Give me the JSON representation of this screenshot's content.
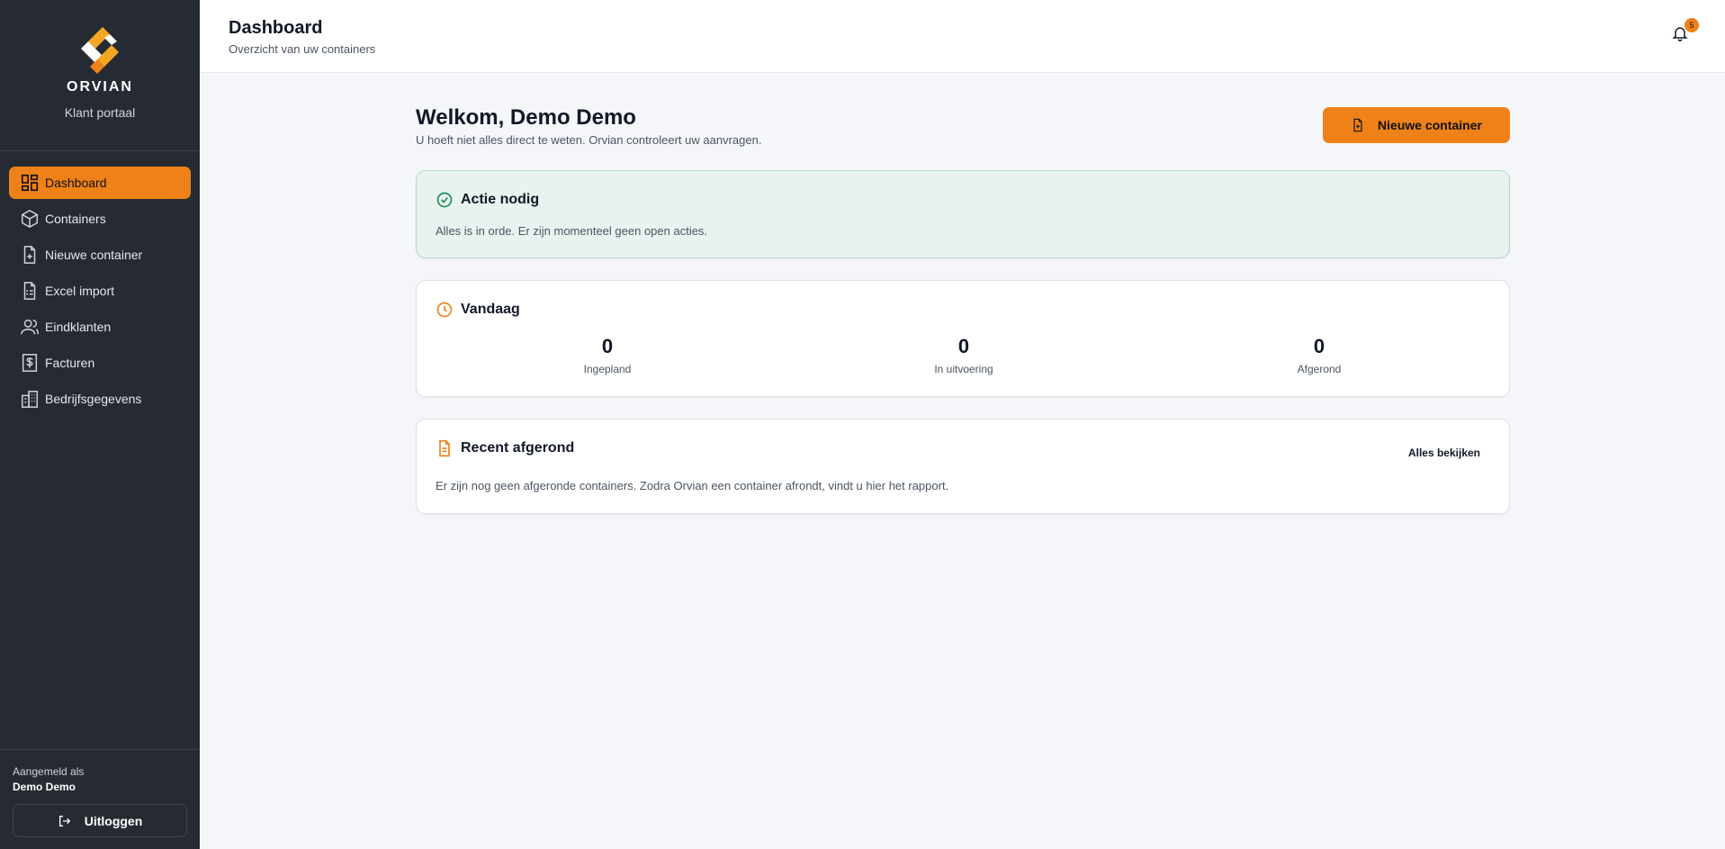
{
  "brand": {
    "name": "ORVIAN",
    "subtitle": "Klant portaal"
  },
  "sidebar": {
    "items": [
      {
        "label": "Dashboard",
        "icon": "dashboard-icon",
        "active": true
      },
      {
        "label": "Containers",
        "icon": "box-icon"
      },
      {
        "label": "Nieuwe container",
        "icon": "file-plus-icon"
      },
      {
        "label": "Excel import",
        "icon": "spreadsheet-icon"
      },
      {
        "label": "Eindklanten",
        "icon": "users-icon"
      },
      {
        "label": "Facturen",
        "icon": "invoice-icon"
      },
      {
        "label": "Bedrijfsgegevens",
        "icon": "building-icon"
      }
    ],
    "footer": {
      "signed_in_label": "Aangemeld als",
      "user_name": "Demo Demo",
      "logout_label": "Uitloggen"
    }
  },
  "header": {
    "title": "Dashboard",
    "subtitle": "Overzicht van uw containers",
    "notification_count": "5"
  },
  "main": {
    "welcome": "Welkom, Demo Demo",
    "welcome_sub": "U hoeft niet alles direct te weten. Orvian controleert uw aanvragen.",
    "new_container_label": "Nieuwe container",
    "action_card": {
      "title": "Actie nodig",
      "text": "Alles is in orde. Er zijn momenteel geen open acties."
    },
    "today_card": {
      "title": "Vandaag",
      "stats": [
        {
          "value": "0",
          "label": "Ingepland"
        },
        {
          "value": "0",
          "label": "In uitvoering"
        },
        {
          "value": "0",
          "label": "Afgerond"
        }
      ]
    },
    "recent_card": {
      "title": "Recent afgerond",
      "view_all": "Alles bekijken",
      "text": "Er zijn nog geen afgeronde containers. Zodra Orvian een container afrondt, vindt u hier het rapport."
    }
  },
  "colors": {
    "accent": "#ee8218",
    "sidebar_bg": "#262b33",
    "success": "#1f8a5a"
  }
}
